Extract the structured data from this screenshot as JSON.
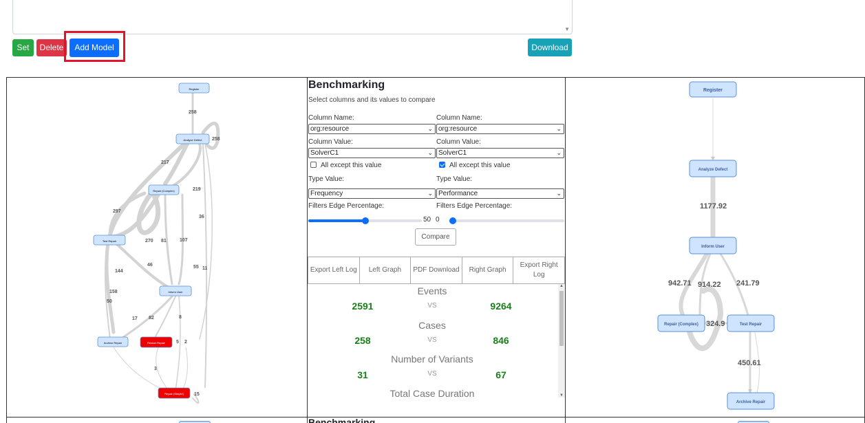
{
  "toolbar": {
    "set_label": "Set",
    "delete_label": "Delete",
    "add_model_label": "Add Model",
    "download_label": "Download",
    "highlight_color": "#e0142a"
  },
  "left_graph": {
    "nodes": [
      "Register",
      "Analyze Defect",
      "Repair (Complex)",
      "Test Repair",
      "Inform User",
      "Archive Repair",
      "Restart Repair",
      "Repair (Simple)"
    ],
    "edge_labels": [
      "258",
      "258",
      "217",
      "219",
      "297",
      "36",
      "270",
      "81",
      "107",
      "144",
      "46",
      "55",
      "11",
      "158",
      "50",
      "17",
      "82",
      "8",
      "5",
      "2",
      "3",
      "15"
    ],
    "highlight_color": "#ee0000"
  },
  "benchmark": {
    "title": "Benchmarking",
    "subtitle": "Select columns and its values to compare",
    "left": {
      "column_name_label": "Column Name:",
      "column_name": "org:resource",
      "column_value_label": "Column Value:",
      "column_value": "SolverC1",
      "except_label": "All except this value",
      "except_checked": false,
      "type_label": "Type Value:",
      "type_value": "Frequency",
      "filter_label": "Filters Edge Percentage:",
      "filter_value": "50"
    },
    "right": {
      "column_name_label": "Column Name:",
      "column_name": "org:resource",
      "column_value_label": "Column Value:",
      "column_value": "SolverC1",
      "except_label": "All except this value",
      "except_checked": true,
      "type_label": "Type Value:",
      "type_value": "Performance",
      "filter_label": "Filters Edge Percentage:",
      "filter_value": "0"
    },
    "compare_label": "Compare",
    "tabs": [
      "Export Left Log",
      "Left Graph",
      "PDF Download",
      "Right Graph",
      "Export Right Log"
    ],
    "vs": "VS",
    "stats": [
      {
        "label": "Events",
        "left": "2591",
        "right": "9264"
      },
      {
        "label": "Cases",
        "left": "258",
        "right": "846"
      },
      {
        "label": "Number of Variants",
        "left": "31",
        "right": "67"
      },
      {
        "label": "Total Case Duration"
      }
    ]
  },
  "right_graph": {
    "nodes": [
      "Register",
      "Analyze Defect",
      "Inform User",
      "Repair (Complex)",
      "Test Repair",
      "Archive Repair"
    ],
    "edge_labels": [
      "1177.92",
      "942.71",
      "914.22",
      "241.79",
      "324.9",
      "450.61"
    ]
  },
  "bottom": {
    "title": "Benchmarking"
  }
}
